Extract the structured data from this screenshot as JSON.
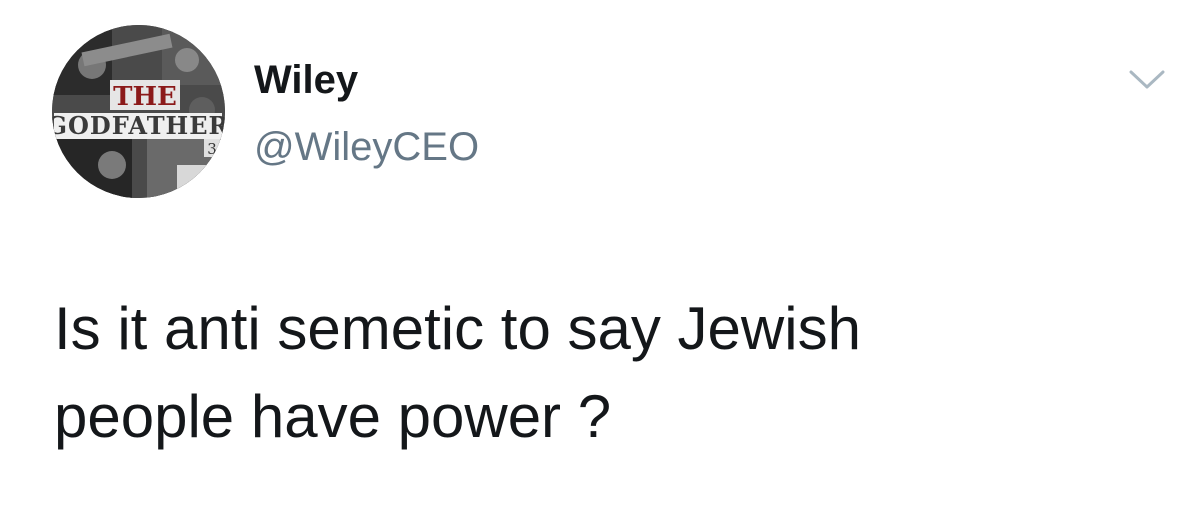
{
  "user": {
    "display_name": "Wiley",
    "handle": "@WileyCEO",
    "avatar_text_top": "THE",
    "avatar_text_main": "GODFATHER",
    "avatar_text_num": "3"
  },
  "tweet": {
    "line1": "Is it anti semetic to say Jewish",
    "line2": "people have power ?"
  },
  "icons": {
    "menu": "chevron-down-icon"
  },
  "colors": {
    "name": "#14171a",
    "handle": "#657786",
    "chevron": "#aab8c2"
  }
}
